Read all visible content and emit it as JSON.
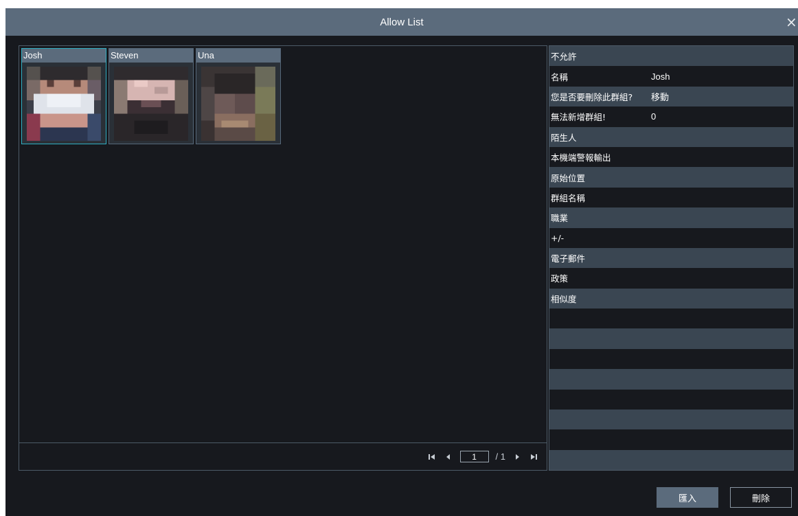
{
  "window": {
    "title": "Allow List",
    "close_icon": "×"
  },
  "people": [
    {
      "name": "Josh",
      "selected": true
    },
    {
      "name": "Steven",
      "selected": false
    },
    {
      "name": "Una",
      "selected": false
    }
  ],
  "pager": {
    "current_page": "1",
    "total": "/ 1"
  },
  "properties": [
    {
      "key": "不允許",
      "value": ""
    },
    {
      "key": "名稱",
      "value": "Josh"
    },
    {
      "key": "您是否要刪除此群組?",
      "value": "移動"
    },
    {
      "key": "無法新增群組!",
      "value": "0"
    },
    {
      "key": "陌生人",
      "value": ""
    },
    {
      "key": "本機端警報輸出",
      "value": ""
    },
    {
      "key": "原始位置",
      "value": ""
    },
    {
      "key": "群組名稱",
      "value": ""
    },
    {
      "key": "職業",
      "value": ""
    },
    {
      "key": "+/-",
      "value": ""
    },
    {
      "key": "電子郵件",
      "value": ""
    },
    {
      "key": "政策",
      "value": ""
    },
    {
      "key": "相似度",
      "value": ""
    },
    {
      "key": "",
      "value": ""
    },
    {
      "key": "",
      "value": ""
    },
    {
      "key": "",
      "value": ""
    },
    {
      "key": "",
      "value": ""
    },
    {
      "key": "",
      "value": ""
    },
    {
      "key": "",
      "value": ""
    },
    {
      "key": "",
      "value": ""
    },
    {
      "key": "",
      "value": ""
    }
  ],
  "buttons": {
    "import_label": "匯入",
    "delete_label": "刪除"
  },
  "colors": {
    "titlebar": "#5b6b7c",
    "selected_border": "#2fb0c4",
    "background": "#17191e"
  }
}
